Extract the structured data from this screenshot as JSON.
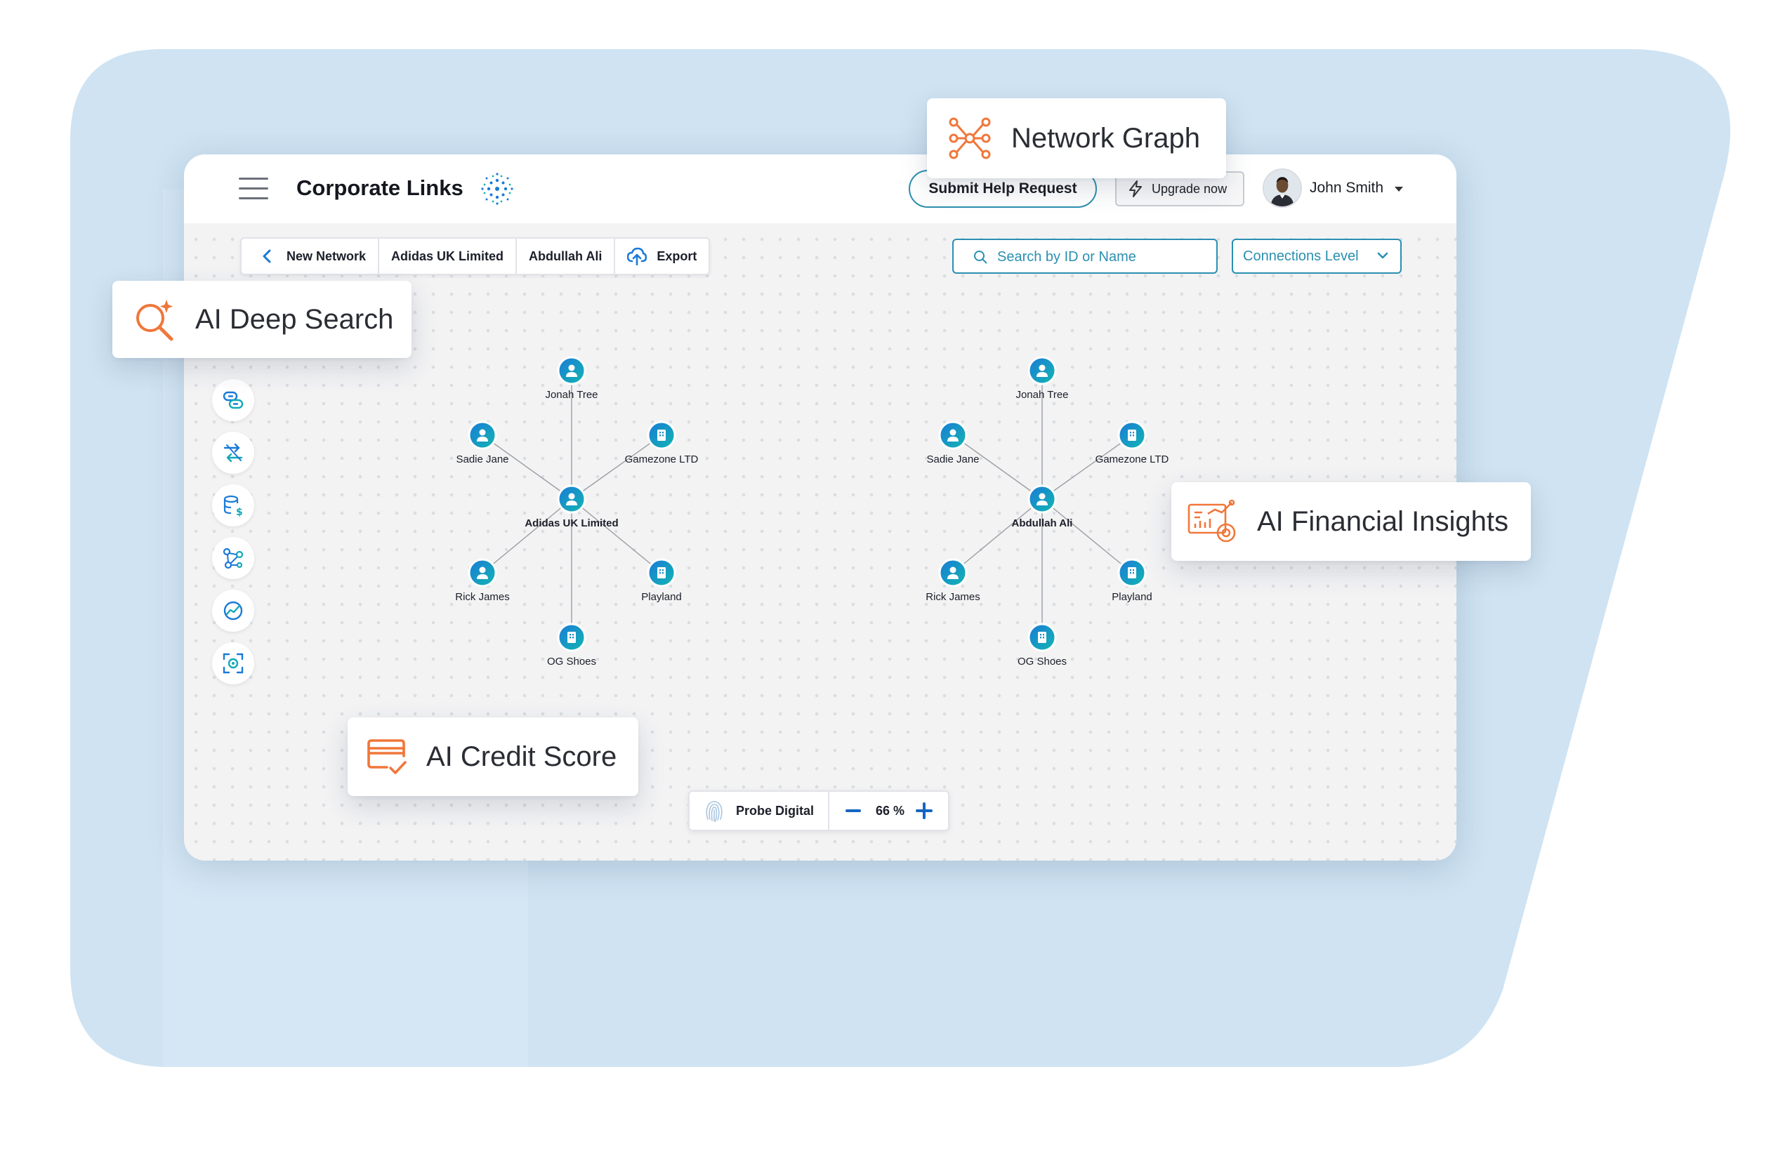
{
  "app": {
    "title": "Corporate Links",
    "help_button": "Submit Help Request",
    "upgrade_button": "Upgrade now",
    "user_name": "John Smith"
  },
  "toolbar": {
    "back_label": "New Network",
    "crumb_company": "Adidas UK Limited",
    "crumb_person": "Abdullah Ali",
    "export_label": "Export"
  },
  "search": {
    "placeholder": "Search by ID or Name"
  },
  "connections_select": {
    "value": "Connections Level"
  },
  "side_rail": {
    "icons": [
      "link-chain-icon",
      "transfer-icon",
      "database-dollar-icon",
      "network-nodes-icon",
      "globe-trend-icon",
      "focus-scan-icon"
    ]
  },
  "graphs": [
    {
      "center": {
        "label": "Adidas UK Limited",
        "type": "person"
      },
      "nodes": [
        {
          "label": "Jonah Tree",
          "type": "person"
        },
        {
          "label": "Sadie Jane",
          "type": "person"
        },
        {
          "label": "Gamezone LTD",
          "type": "company"
        },
        {
          "label": "Rick James",
          "type": "person"
        },
        {
          "label": "Playland",
          "type": "company"
        },
        {
          "label": "OG Shoes",
          "type": "company"
        }
      ]
    },
    {
      "center": {
        "label": "Abdullah Ali",
        "type": "person"
      },
      "nodes": [
        {
          "label": "Jonah Tree",
          "type": "person"
        },
        {
          "label": "Sadie Jane",
          "type": "person"
        },
        {
          "label": "Gamezone LTD",
          "type": "company"
        },
        {
          "label": "Rick James",
          "type": "person"
        },
        {
          "label": "Playland",
          "type": "company"
        },
        {
          "label": "OG Shoes",
          "type": "company"
        }
      ]
    }
  ],
  "bottom_bar": {
    "brand": "Probe Digital",
    "zoom": "66 %"
  },
  "feature_cards": {
    "network_graph": "Network Graph",
    "deep_search": "AI Deep Search",
    "financial_insights": "AI Financial Insights",
    "credit_score": "AI Credit Score"
  },
  "colors": {
    "background_shape": "#cfe3f2",
    "accent_teal": "#2b8fb0",
    "node_gradient_start": "#1a7ad8",
    "node_gradient_end": "#12b7b0",
    "feature_orange": "#f0773a"
  }
}
